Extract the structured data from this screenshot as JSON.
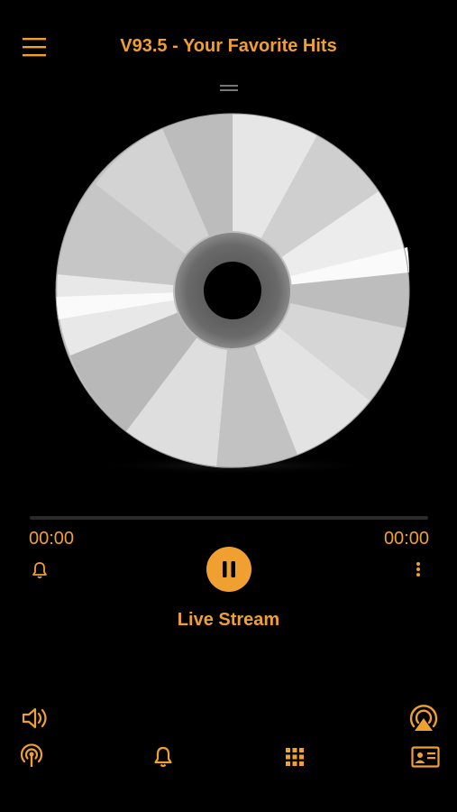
{
  "header": {
    "title": "V93.5 - Your Favorite Hits",
    "menu_icon": "hamburger-menu-icon"
  },
  "player": {
    "elapsed": "00:00",
    "duration": "00:00",
    "progress": 0,
    "stream_label": "Live Stream",
    "state": "playing",
    "artwork_icon": "cd-disc-icon"
  },
  "controls": {
    "alarm_icon": "bell-icon",
    "play_pause_icon": "pause-icon",
    "more_icon": "more-vertical-icon"
  },
  "bottom_bar": {
    "volume_icon": "speaker-volume-icon",
    "airplay_icon": "airplay-icon",
    "broadcast_icon": "broadcast-icon",
    "notifications_icon": "bell-icon",
    "grid_icon": "grid-icon",
    "contact_icon": "contact-card-icon"
  },
  "colors": {
    "accent": "#f0a030",
    "background": "#000000",
    "track": "#2a2a2a"
  }
}
